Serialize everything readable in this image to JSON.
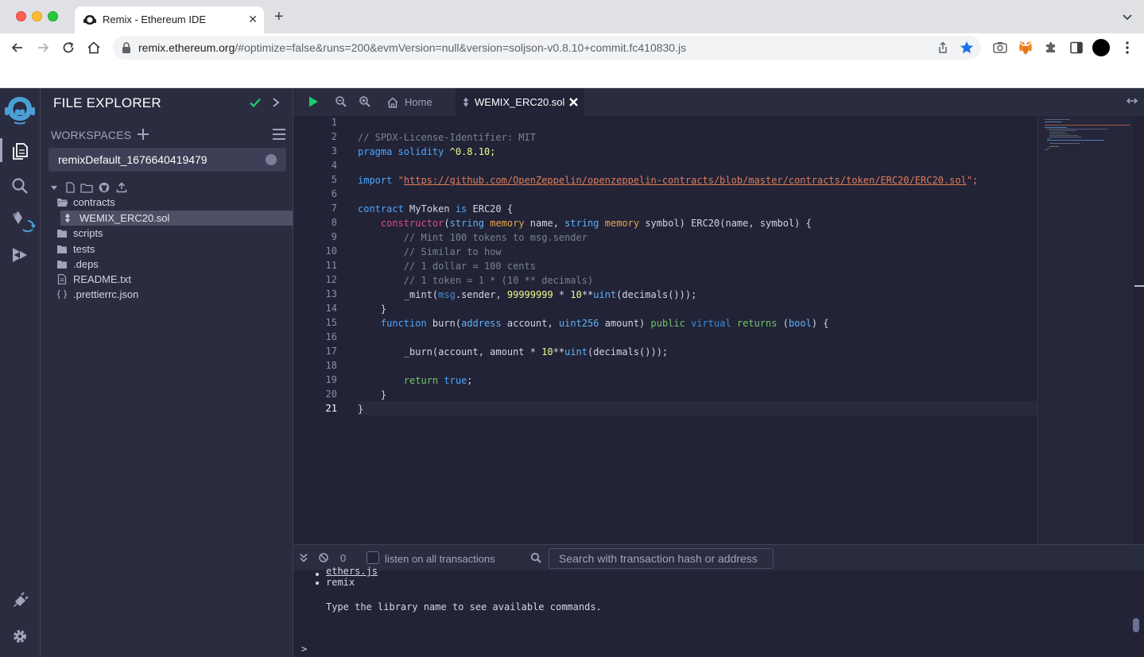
{
  "browser": {
    "tab_title": "Remix - Ethereum IDE",
    "new_tab": "+",
    "url_domain": "remix.ethereum.org",
    "url_rest": "/#optimize=false&runs=200&evmVersion=null&version=soljson-v0.8.10+commit.fc410830.js"
  },
  "sidepanel": {
    "title": "FILE EXPLORER",
    "workspaces_label": "WORKSPACES",
    "workspace_name": "remixDefault_1676640419479",
    "tree": [
      {
        "label": "contracts",
        "type": "folder"
      },
      {
        "label": "WEMIX_ERC20.sol",
        "type": "file-sol",
        "selected": true
      },
      {
        "label": "scripts",
        "type": "folder"
      },
      {
        "label": "tests",
        "type": "folder"
      },
      {
        "label": ".deps",
        "type": "folder"
      },
      {
        "label": "README.txt",
        "type": "file"
      },
      {
        "label": ".prettierrc.json",
        "type": "json"
      }
    ]
  },
  "editor": {
    "tabs": [
      {
        "label": "Home",
        "icon": "home-icon"
      },
      {
        "label": "WEMIX_ERC20.sol",
        "icon": "solidity-icon",
        "active": true
      }
    ],
    "line_numbers": [
      "1",
      "2",
      "3",
      "4",
      "5",
      "6",
      "7",
      "8",
      "9",
      "10",
      "11",
      "12",
      "13",
      "14",
      "15",
      "16",
      "17",
      "18",
      "19",
      "20",
      "21"
    ],
    "current_line": "21",
    "code": {
      "l2": "// SPDX-License-Identifier: MIT",
      "l3_kw": "pragma solidity",
      "l3_ver": " ^0.8.10;",
      "l5_kw": "import",
      "l5_q1": " \"",
      "l5_url": "https://github.com/OpenZeppelin/openzeppelin-contracts/blob/master/contracts/token/ERC20/ERC20.sol",
      "l5_q2": "\";",
      "l7_kw": "contract",
      "l7_name": " MyToken ",
      "l7_is": "is",
      "l7_rest": " ERC20 {",
      "l8_ind": "    ",
      "l8_ctor": "constructor",
      "l8_p1": "(",
      "l8_t1": "string",
      "l8_sp1": " ",
      "l8_m1": "memory",
      "l8_n1": " name, ",
      "l8_t2": "string",
      "l8_sp2": " ",
      "l8_m2": "memory",
      "l8_rest": " symbol) ERC20(name, symbol) {",
      "l9": "        // Mint 100 tokens to msg.sender",
      "l10": "        // Similar to how",
      "l11": "        // 1 dollar = 100 cents",
      "l12": "        // 1 token = 1 * (10 ** decimals)",
      "l13_a": "        _mint(",
      "l13_msg": "msg",
      "l13_b": ".sender, ",
      "l13_n1": "99999999",
      "l13_c": " * ",
      "l13_n2": "10",
      "l13_d": "**",
      "l13_uint": "uint",
      "l13_e": "(decimals()));",
      "l14": "    }",
      "l15_ind": "    ",
      "l15_fn": "function",
      "l15_name": " burn(",
      "l15_addr": "address",
      "l15_acc": " account, ",
      "l15_u256": "uint256",
      "l15_amt": " amount) ",
      "l15_pub": "public",
      "l15_sp": " ",
      "l15_vir": "virtual",
      "l15_sp2": " ",
      "l15_ret": "returns",
      "l15_p": " (",
      "l15_bool": "bool",
      "l15_end": ") {",
      "l17_a": "        _burn(account, amount * ",
      "l17_n": "10",
      "l17_b": "**",
      "l17_uint": "uint",
      "l17_c": "(decimals()));",
      "l19_ind": "        ",
      "l19_ret": "return",
      "l19_sp": " ",
      "l19_true": "true",
      "l19_end": ";",
      "l20": "    }",
      "l21": "}"
    }
  },
  "terminal": {
    "count": "0",
    "listen_label": "listen on all transactions",
    "search_placeholder": "Search with transaction hash or address",
    "line_ethers": "ethers.js",
    "line_remix": "remix",
    "line_hint": "Type the library name to see available commands.",
    "prompt": ">"
  }
}
